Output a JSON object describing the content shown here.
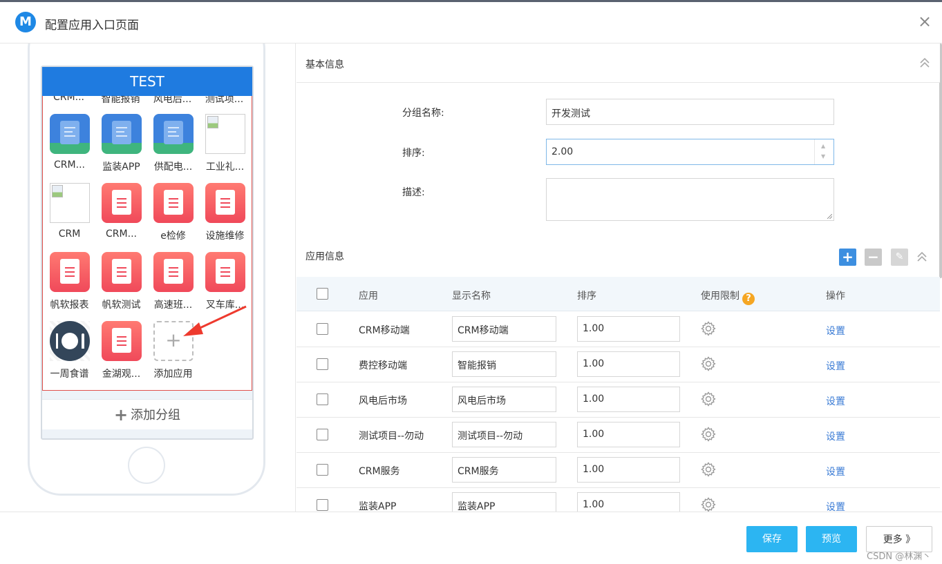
{
  "window": {
    "title": "配置应用入口页面",
    "logo_letter": "M",
    "close_glyph": "×"
  },
  "phone": {
    "group_title": "TEST",
    "top_row_labels": [
      "CRM...",
      "智能报销",
      "风电后...",
      "测试项..."
    ],
    "apps": [
      {
        "label": "CRM...",
        "icon": "doc-blue-icon"
      },
      {
        "label": "监装APP",
        "icon": "doc-blue-icon"
      },
      {
        "label": "供配电...",
        "icon": "doc-blue-icon"
      },
      {
        "label": "工业礼...",
        "icon": "broken-image-icon"
      },
      {
        "label": "CRM",
        "icon": "broken-image-icon"
      },
      {
        "label": "CRM...",
        "icon": "doc-red-icon"
      },
      {
        "label": "e检修",
        "icon": "doc-red-icon"
      },
      {
        "label": "设施维修",
        "icon": "doc-red-icon"
      },
      {
        "label": "帆软报表",
        "icon": "doc-red-icon"
      },
      {
        "label": "帆软测试",
        "icon": "doc-red-icon"
      },
      {
        "label": "高速班...",
        "icon": "doc-red-icon"
      },
      {
        "label": "叉车库...",
        "icon": "doc-red-icon"
      },
      {
        "label": "一周食谱",
        "icon": "food-plate-icon"
      },
      {
        "label": "金湖观...",
        "icon": "doc-red-icon"
      },
      {
        "label": "添加应用",
        "icon": "add-app-icon"
      }
    ],
    "add_app_glyph": "+",
    "add_group_plus": "+",
    "add_group_label": "添加分组"
  },
  "basic": {
    "section_title": "基本信息",
    "group_name_label": "分组名称:",
    "group_name_value": "开发测试",
    "order_label": "排序:",
    "order_value": "2.00",
    "desc_label": "描述:",
    "desc_value": ""
  },
  "apps_section": {
    "section_title": "应用信息",
    "headers": {
      "app": "应用",
      "display_name": "显示名称",
      "order": "排序",
      "restriction": "使用限制",
      "restriction_help": "?",
      "action": "操作"
    },
    "rows": [
      {
        "app": "CRM移动端",
        "display_name": "CRM移动端",
        "order": "1.00",
        "action": "设置"
      },
      {
        "app": "费控移动端",
        "display_name": "智能报销",
        "order": "1.00",
        "action": "设置"
      },
      {
        "app": "风电后市场",
        "display_name": "风电后市场",
        "order": "1.00",
        "action": "设置"
      },
      {
        "app": "测试项目--勿动",
        "display_name": "测试项目--勿动",
        "order": "1.00",
        "action": "设置"
      },
      {
        "app": "CRM服务",
        "display_name": "CRM服务",
        "order": "1.00",
        "action": "设置"
      },
      {
        "app": "监装APP",
        "display_name": "监装APP",
        "order": "1.00",
        "action": "设置"
      }
    ]
  },
  "footer": {
    "save": "保存",
    "preview": "预览",
    "more": "更多 》",
    "watermark": "CSDN @林渊丶"
  },
  "colors": {
    "accent": "#1f7be0",
    "button": "#2cb5f2",
    "link": "#3a7bd5",
    "help": "#f5a623"
  }
}
